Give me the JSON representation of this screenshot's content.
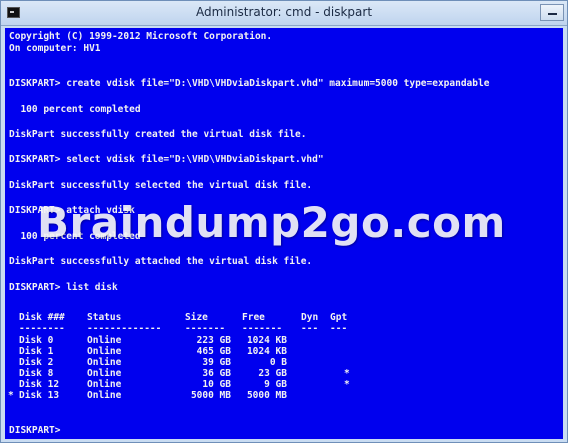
{
  "window": {
    "title": "Administrator: cmd - diskpart"
  },
  "console": {
    "lines": [
      "Copyright (C) 1999-2012 Microsoft Corporation.",
      "On computer: HV1",
      "DISKPART> create vdisk file=\"D:\\VHD\\VHDviaDiskpart.vhd\" maximum=5000 type=expandable",
      "  100 percent completed",
      "DiskPart successfully created the virtual disk file.",
      "DISKPART> select vdisk file=\"D:\\VHD\\VHDviaDiskpart.vhd\"",
      "DiskPart successfully selected the virtual disk file.",
      "DISKPART> attach vdisk",
      "  100 percent completed",
      "DiskPart successfully attached the virtual disk file.",
      "DISKPART> list disk"
    ],
    "prompt": "DISKPART>"
  },
  "watermark": "Braindump2go.com",
  "disk_table": {
    "headers": {
      "disk": "Disk ###",
      "status": "Status",
      "size": "Size",
      "free": "Free",
      "dyn": "Dyn",
      "gpt": "Gpt"
    },
    "separators": {
      "disk": "--------",
      "status": "-------------",
      "size": "-------",
      "free": "-------",
      "dyn": "---",
      "gpt": "---"
    },
    "rows": [
      {
        "sel": "",
        "disk": "Disk 0",
        "status": "Online",
        "size": "223 GB",
        "free": "1024 KB",
        "dyn": "",
        "gpt": ""
      },
      {
        "sel": "",
        "disk": "Disk 1",
        "status": "Online",
        "size": "465 GB",
        "free": "1024 KB",
        "dyn": "",
        "gpt": ""
      },
      {
        "sel": "",
        "disk": "Disk 2",
        "status": "Online",
        "size": "39 GB",
        "free": "0 B",
        "dyn": "",
        "gpt": ""
      },
      {
        "sel": "",
        "disk": "Disk 8",
        "status": "Online",
        "size": "36 GB",
        "free": "23 GB",
        "dyn": "",
        "gpt": "*"
      },
      {
        "sel": "",
        "disk": "Disk 12",
        "status": "Online",
        "size": "10 GB",
        "free": "9 GB",
        "dyn": "",
        "gpt": "*"
      },
      {
        "sel": "*",
        "disk": "Disk 13",
        "status": "Online",
        "size": "5000 MB",
        "free": "5000 MB",
        "dyn": "",
        "gpt": ""
      }
    ]
  },
  "colors": {
    "console_bg": "#0000ee",
    "console_text": "#f2f2f2",
    "titlebar": "#c9dcf2"
  }
}
